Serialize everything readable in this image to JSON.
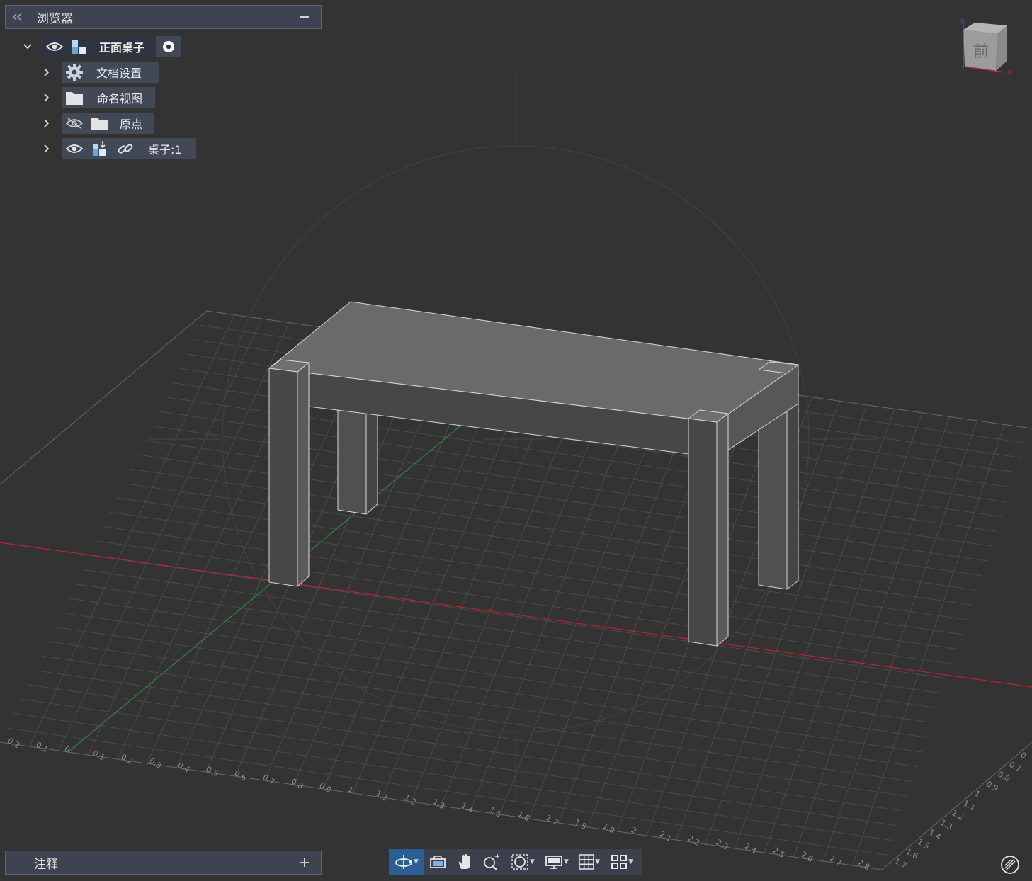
{
  "browser": {
    "title": "浏览器",
    "collapse_icon": "double-chevron-left-icon",
    "minimize_icon": "minus-icon",
    "root": {
      "label": "正面桌子"
    },
    "items": [
      {
        "label": "文档设置"
      },
      {
        "label": "命名视图"
      },
      {
        "label": "原点"
      },
      {
        "label": "桌子:1"
      }
    ]
  },
  "annotations": {
    "title": "注释",
    "add_icon": "plus-icon"
  },
  "viewcube": {
    "face_label": "前",
    "axis_x": "X",
    "axis_z": "Z"
  },
  "ruler": {
    "front_ticks": [
      "0.2",
      "0.1",
      "0",
      "0.1",
      "0.2",
      "0.3",
      "0.4",
      "0.5",
      "0.6",
      "0.7",
      "0.8",
      "0.9",
      "1",
      "1.1",
      "1.2",
      "1.3",
      "1.4",
      "1.5",
      "1.6",
      "1.7",
      "1.8",
      "1.9",
      "2",
      "2.1",
      "2.2",
      "2.3",
      "2.4",
      "2.5",
      "2.6",
      "2.7",
      "2.8"
    ],
    "right_ticks": [
      "0",
      "0.7",
      "0.8",
      "0.9",
      "1",
      "1.1",
      "1.2",
      "1.3",
      "1.4",
      "1.5",
      "1.6",
      "1.7"
    ]
  },
  "toolbar": {
    "icons": [
      "orbit-icon",
      "camera-icon",
      "pan-hand-icon",
      "zoom-icon",
      "zoom-window-icon",
      "display-settings-icon",
      "grid-icon",
      "viewports-icon"
    ]
  },
  "colors": {
    "background": "#333333",
    "panel_header": "#3d4350",
    "node_bg": "#414957",
    "x_axis": "#b8262e",
    "y_axis": "#2f8a36",
    "toolbar_active": "#2b5f93"
  }
}
